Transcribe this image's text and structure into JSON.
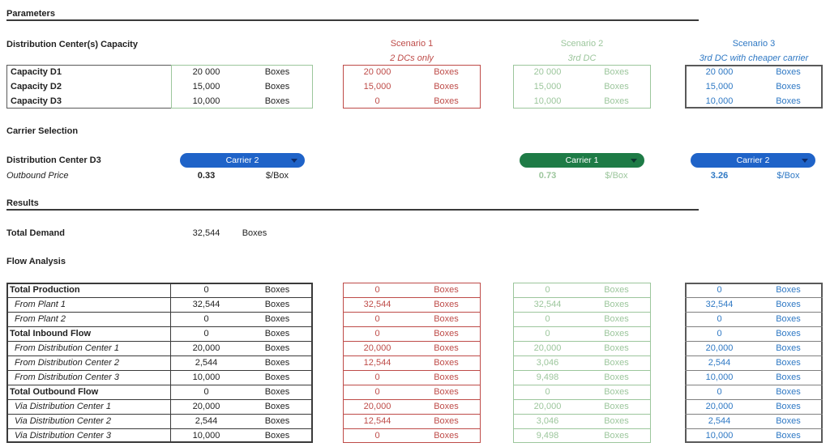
{
  "colors": {
    "scenario1_red": "#BE4B48",
    "scenario2_green": "#9CC69C",
    "scenario3_blue": "#2E78C4",
    "carrier_pill_blue": "#1F63C8",
    "carrier_pill_green": "#1E7B46",
    "table_border_dark": "#595959"
  },
  "parameters": {
    "title": "Parameters"
  },
  "scenarios": [
    {
      "name": "Scenario 1",
      "subtitle": "2 DCs only"
    },
    {
      "name": "Scenario 2",
      "subtitle": "3rd DC"
    },
    {
      "name": "Scenario 3",
      "subtitle": "3rd DC with cheaper carrier"
    }
  ],
  "capacity": {
    "title": "Distribution Center(s) Capacity",
    "unit": "Boxes",
    "rows": [
      {
        "label": "Capacity D1",
        "base": "20 000",
        "s1": "20 000",
        "s2": "20 000",
        "s3": "20 000"
      },
      {
        "label": "Capacity D2",
        "base": "15,000",
        "s1": "15,000",
        "s2": "15,000",
        "s3": "15,000"
      },
      {
        "label": "Capacity D3",
        "base": "10,000",
        "s1": "0",
        "s2": "10,000",
        "s3": "10,000"
      }
    ]
  },
  "carrier": {
    "title": "Carrier Selection",
    "row_label": "Distribution Center D3",
    "price_label": "Outbound Price",
    "unit": "$/Box",
    "base": {
      "name": "Carrier 2",
      "price": "0.33"
    },
    "s2": {
      "name": "Carrier 1",
      "price": "0.73"
    },
    "s3": {
      "name": "Carrier 2",
      "price": "3.26"
    }
  },
  "results": {
    "title": "Results",
    "total_demand_label": "Total Demand",
    "total_demand_value": "32,544",
    "unit": "Boxes"
  },
  "flow": {
    "title": "Flow Analysis",
    "unit": "Boxes",
    "rows": [
      {
        "label": "Total Production",
        "style": "bold",
        "base": "0",
        "s1": "0",
        "s2": "0",
        "s3": "0"
      },
      {
        "label": "From Plant 1",
        "style": "italic",
        "base": "32,544",
        "s1": "32,544",
        "s2": "32,544",
        "s3": "32,544"
      },
      {
        "label": "From Plant 2",
        "style": "italic",
        "base": "0",
        "s1": "0",
        "s2": "0",
        "s3": "0"
      },
      {
        "label": "Total Inbound Flow",
        "style": "bold",
        "base": "0",
        "s1": "0",
        "s2": "0",
        "s3": "0"
      },
      {
        "label": "From Distribution Center 1",
        "style": "italic",
        "base": "20,000",
        "s1": "20,000",
        "s2": "20,000",
        "s3": "20,000"
      },
      {
        "label": "From Distribution Center 2",
        "style": "italic",
        "base": "2,544",
        "s1": "12,544",
        "s2": "3,046",
        "s3": "2,544"
      },
      {
        "label": "From Distribution Center 3",
        "style": "italic",
        "base": "10,000",
        "s1": "0",
        "s2": "9,498",
        "s3": "10,000"
      },
      {
        "label": "Total Outbound Flow",
        "style": "bold",
        "base": "0",
        "s1": "0",
        "s2": "0",
        "s3": "0"
      },
      {
        "label": "Via Distribution Center 1",
        "style": "italic",
        "base": "20,000",
        "s1": "20,000",
        "s2": "20,000",
        "s3": "20,000"
      },
      {
        "label": "Via Distribution Center 2",
        "style": "italic",
        "base": "2,544",
        "s1": "12,544",
        "s2": "3,046",
        "s3": "2,544"
      },
      {
        "label": "Via Distribution Center 3",
        "style": "italic",
        "base": "10,000",
        "s1": "0",
        "s2": "9,498",
        "s3": "10,000"
      }
    ]
  }
}
